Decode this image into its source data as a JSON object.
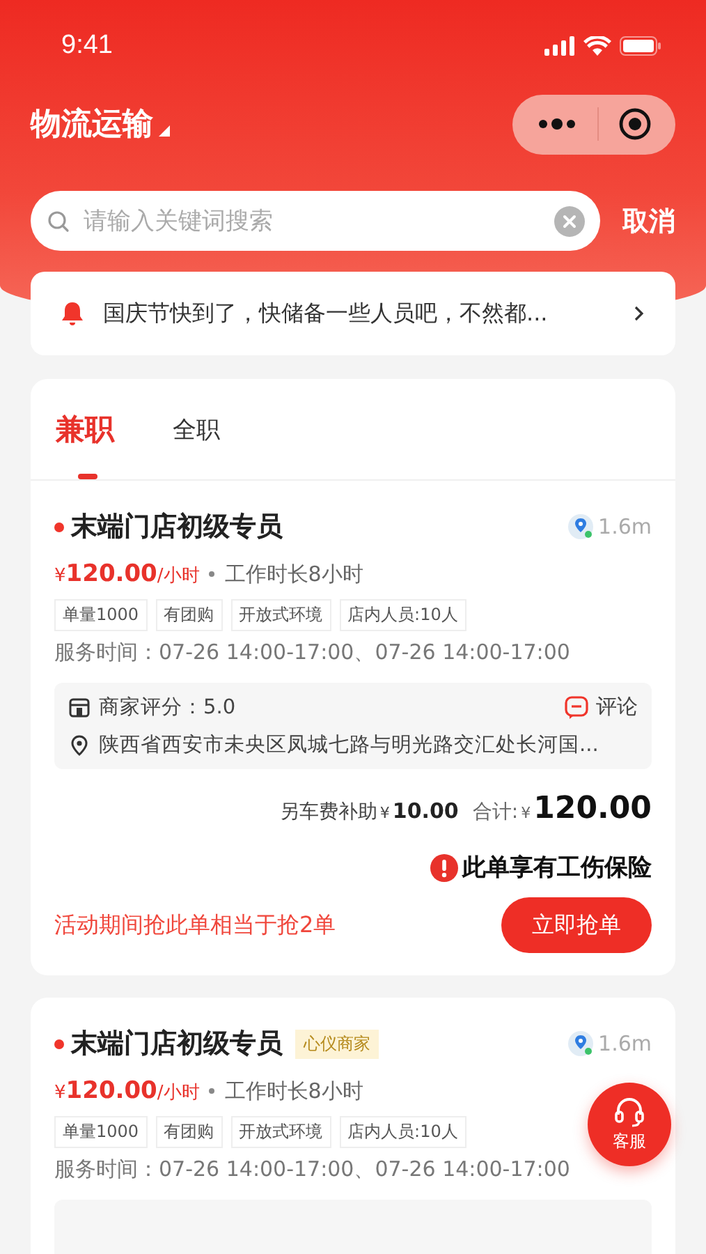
{
  "status_bar": {
    "time": "9:41"
  },
  "header": {
    "title": "物流运输",
    "search": {
      "placeholder": "请输入关键词搜索"
    },
    "cancel": "取消"
  },
  "notice": {
    "text": "国庆节快到了，快储备一些人员吧，不然都..."
  },
  "tabs": [
    {
      "label": "兼职",
      "selected": true
    },
    {
      "label": "全职",
      "selected": false
    }
  ],
  "jobs": [
    {
      "title": "末端门店初级专员",
      "distance": "1.6m",
      "currency": "¥",
      "price": "120.00",
      "price_unit": "/小时",
      "duration": "工作时长8小时",
      "tags": [
        "单量1000",
        "有团购",
        "开放式环境",
        "店内人员:10人"
      ],
      "service_time": "服务时间：07-26 14:00-17:00、07-26 14:00-17:00",
      "rating": "商家评分：5.0",
      "comment": "评论",
      "address": "陕西省西安市未央区凤城七路与明光路交汇处长河国...",
      "subsidy_label": "另车费补助",
      "subsidy_currency": "¥",
      "subsidy": "10.00",
      "total_label": "合计:",
      "total_currency": "¥",
      "total": "120.00",
      "insurance": "此单享有工伤保险",
      "promo": "活动期间抢此单相当于抢2单",
      "action": "立即抢单"
    },
    {
      "title": "末端门店初级专员",
      "badge": "心仪商家",
      "distance": "1.6m",
      "currency": "¥",
      "price": "120.00",
      "price_unit": "/小时",
      "duration": "工作时长8小时",
      "tags": [
        "单量1000",
        "有团购",
        "开放式环境",
        "店内人员:10人"
      ],
      "service_time": "服务时间：07-26 14:00-17:00、07-26 14:00-17:00"
    }
  ],
  "float_button": {
    "label": "客服"
  }
}
